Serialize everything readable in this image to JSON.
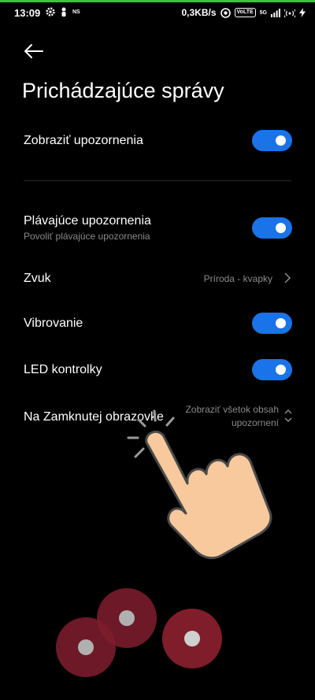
{
  "status_bar": {
    "time": "13:09",
    "ns_label": "NS",
    "speed": "0,3KB/s",
    "vo_label": "VoLTE",
    "net_label": "5G"
  },
  "header": {
    "title": "Prichádzajúce správy"
  },
  "settings": {
    "show_notifications": {
      "label": "Zobraziť upozornenia",
      "enabled": true
    },
    "floating": {
      "label": "Plávajúce upozornenia",
      "sublabel": "Povoliť plávajúce upozornenia",
      "enabled": true
    },
    "sound": {
      "label": "Zvuk",
      "value": "Príroda - kvapky"
    },
    "vibration": {
      "label": "Vibrovanie",
      "enabled": true
    },
    "led": {
      "label": "LED kontrolky",
      "enabled": true
    },
    "lock_screen": {
      "label": "Na Zamknutej obrazovke",
      "value_line1": "Zobraziť všetok obsah",
      "value_line2": "upozornení"
    }
  },
  "colors": {
    "toggle_on": "#1a73e8",
    "status_line": "#3dc43d",
    "secondary_text": "#8a8a8a"
  },
  "icons": [
    "back-arrow-icon",
    "chevron-right-icon",
    "chevron-updown-icon",
    "settings-gear-icon",
    "wifi-icon",
    "signal-icon",
    "bolt-icon",
    "hand-pointer-icon"
  ]
}
